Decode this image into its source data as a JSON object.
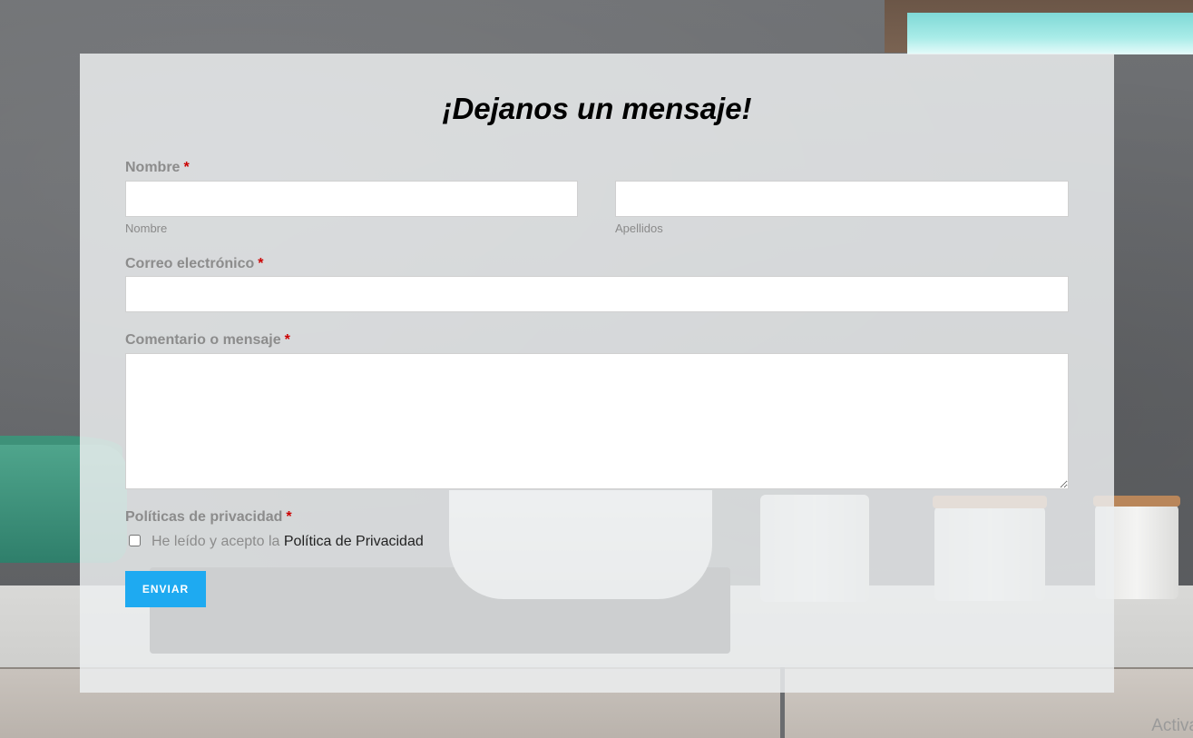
{
  "form": {
    "title": "¡Dejanos un mensaje!",
    "required_marker": "*",
    "name": {
      "label": "Nombre",
      "first_sublabel": "Nombre",
      "last_sublabel": "Apellidos",
      "first_value": "",
      "last_value": ""
    },
    "email": {
      "label": "Correo electrónico",
      "value": ""
    },
    "message": {
      "label": "Comentario o mensaje",
      "value": ""
    },
    "privacy": {
      "label": "Políticas de privacidad",
      "consent_text": "He leído y acepto la",
      "policy_link_text": "Política de Privacidad",
      "checked": false
    },
    "submit_label": "ENVIAR"
  },
  "watermark": "Activa",
  "colors": {
    "accent": "#1eaaf1",
    "required": "#cc0000",
    "label": "#8c8c8c"
  }
}
